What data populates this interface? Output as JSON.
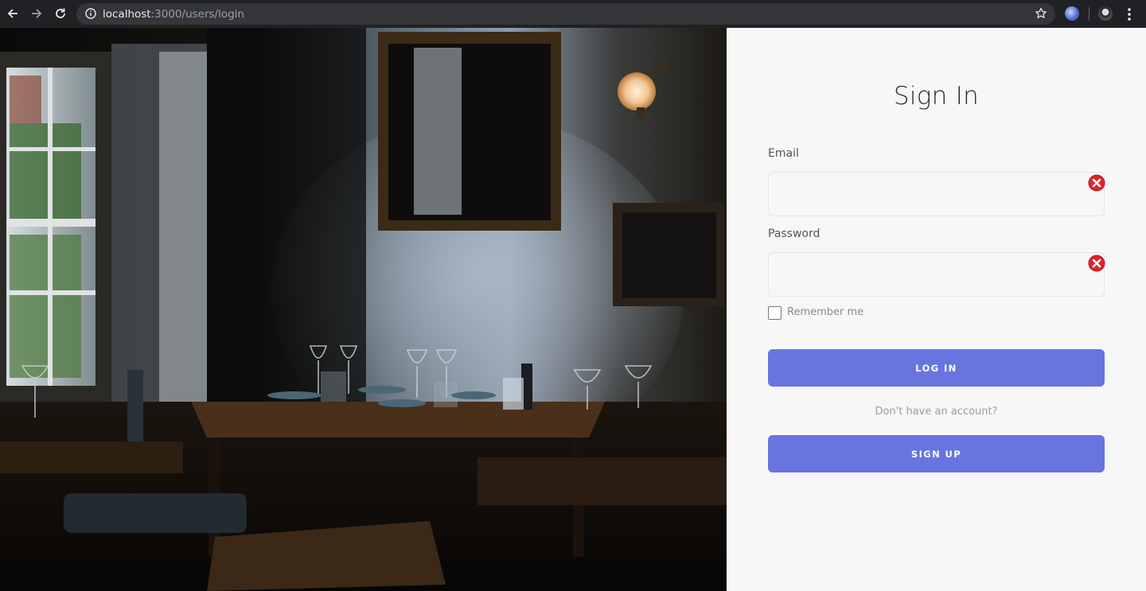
{
  "browser": {
    "url_host": "localhost",
    "url_rest": ":3000/users/login",
    "icons": [
      "back-arrow-icon",
      "forward-arrow-icon",
      "reload-icon",
      "info-icon",
      "star-icon",
      "extension-icon",
      "avatar",
      "menu-dots-icon"
    ]
  },
  "hero": {
    "description_icon": "restaurant-interior-photo"
  },
  "form": {
    "title": "Sign In",
    "email_label": "Email",
    "email_value": "",
    "password_label": "Password",
    "password_value": "",
    "remember_label": "Remember me",
    "remember_checked": false,
    "login_button": "LOG IN",
    "no_account_text": "Don't have an account?",
    "signup_button": "SIGN UP"
  },
  "colors": {
    "accent": "#6874e0",
    "panel_bg": "#f7f7f7",
    "chrome_bg": "#202124",
    "error": "#d9262b"
  }
}
